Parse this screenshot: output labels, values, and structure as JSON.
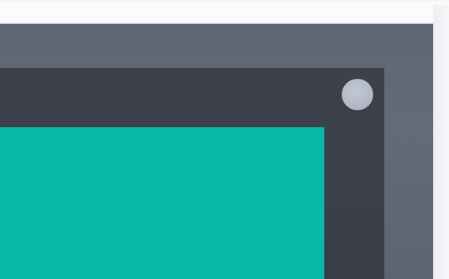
{
  "scene": {
    "colors": {
      "page_background": "#fbfbfc",
      "outer_frame": "#626976",
      "inner_bezel": "#3b404a",
      "screen_panel": "#08b9a8",
      "round_button": "#b5bbc7"
    }
  }
}
